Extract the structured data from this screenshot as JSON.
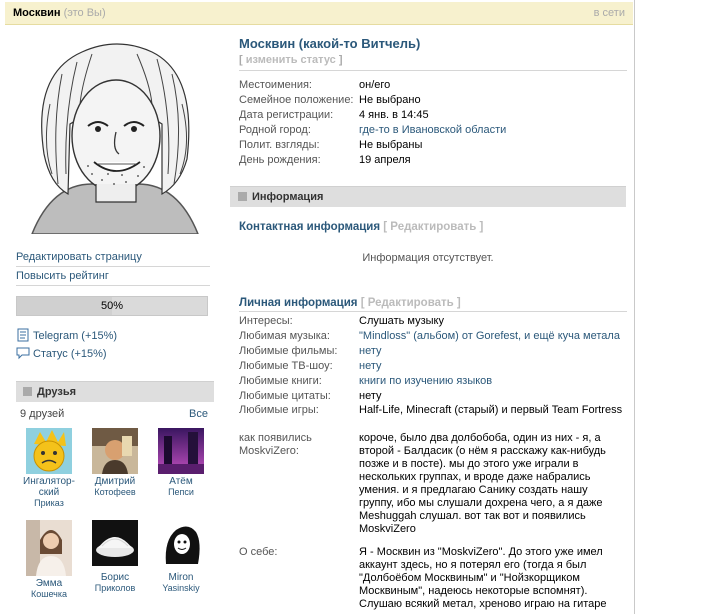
{
  "topbar": {
    "name": "Москвин",
    "you": "(это Вы)",
    "online": "в сети"
  },
  "left": {
    "menu": [
      {
        "label": "Редактировать страницу"
      },
      {
        "label": "Повысить рейтинг"
      }
    ],
    "rating": {
      "label": "50%",
      "value": 0.5
    },
    "bonuses": [
      {
        "label": "Telegram (+15%)",
        "icon": "document-icon"
      },
      {
        "label": "Статус (+15%)",
        "icon": "chat-bubble-icon"
      }
    ],
    "friends": {
      "header": "Друзья",
      "count": "9 друзей",
      "all": "Все",
      "items": [
        {
          "first": "Ингалятор­ский",
          "last": "Приказ",
          "color": "#7ec8d8"
        },
        {
          "first": "Дмитрий",
          "last": "Котофеев",
          "color": "#8a6a4a"
        },
        {
          "first": "Атём",
          "last": "Пепси",
          "color": "#8a3a9a"
        },
        {
          "first": "Эмма",
          "last": "Кошечка",
          "color": "#d8c8b8"
        },
        {
          "first": "Борис",
          "last": "Приколов",
          "color": "#eaeaea"
        },
        {
          "first": "Miron",
          "last": "Yasinskiy",
          "color": "#ffffff"
        }
      ]
    }
  },
  "profile": {
    "title": "Москвин (какой-то Витчель)",
    "status_prefix": "[",
    "status_link": "изменить статус",
    "status_suffix": "]",
    "basic": [
      {
        "k": "Местоимения:",
        "v": "он/его",
        "link": false
      },
      {
        "k": "Семейное положение:",
        "v": "Не выбрано",
        "link": false
      },
      {
        "k": "Дата регистрации:",
        "v": "4 янв. в 14:45",
        "link": false
      },
      {
        "k": "Родной город:",
        "v": "где-то в Ивановской области",
        "link": true
      },
      {
        "k": "Полит. взгляды:",
        "v": "Не выбраны",
        "link": false
      },
      {
        "k": "День рождения:",
        "v": "19 апреля",
        "link": false
      }
    ],
    "info_header": "Информация",
    "contact": {
      "title": "Контактная информация",
      "edit": "[ Редактировать ]",
      "empty": "Информация отсутствует."
    },
    "personal": {
      "title": "Личная информация",
      "edit": "[ Редактировать ]",
      "rows": [
        {
          "k": "Интересы:",
          "v": "Слушать музыку",
          "link": false
        },
        {
          "k": "Любимая музыка:",
          "v": "\"Mindloss\" (альбом) от Gorefest, и ещё куча метала",
          "link": true
        },
        {
          "k": "Любимые фильмы:",
          "v": "нету",
          "link": true
        },
        {
          "k": "Любимые ТВ-шоу:",
          "v": "нету",
          "link": true
        },
        {
          "k": "Любимые книги:",
          "v": "книги по изучению языков",
          "link": true
        },
        {
          "k": "Любимые цитаты:",
          "v": "нету",
          "link": false
        },
        {
          "k": "Любимые игры:",
          "v": "Half-Life, Minecraft (старый) и первый Team Fortress",
          "link": false
        },
        {
          "k": "как появились MoskviZero:",
          "v": "короче, было два долбобоба, один из них - я, а второй - Балдасик (о нём я расскажу как-нибудь позже и в посте). мы до этого уже играли в нескольких группах, и вроде даже набрались умения. и я предлагаю Санику создать нашу группу, ибо мы слушали дохрена чего, а я даже Meshuggah слушал. вот так вот и появились MoskviZero",
          "link": false
        },
        {
          "k": "О себе:",
          "v": "Я - Москвин из \"MoskviZero\". До этого уже имел аккаунт здесь, но я потерял его (тогда я был \"Долбоёбом Москвиным\" и \"Нойзкорщиком Москвиным\", надеюсь некоторые вспомнят). Слушаю всякий метал, хреново играю на гитаре",
          "link": false
        }
      ]
    }
  }
}
